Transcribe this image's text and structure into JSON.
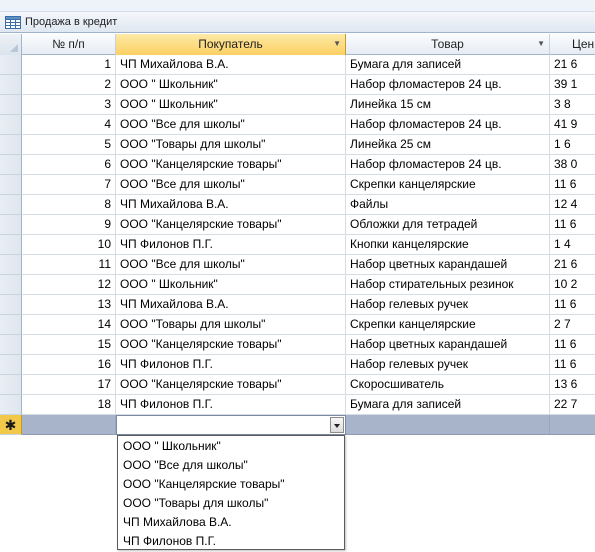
{
  "window": {
    "title": "Продажа в кредит",
    "icon": "table-icon"
  },
  "columns": {
    "num": "№ п/п",
    "buyer": "Покупатель",
    "item": "Товар",
    "price": "Цен"
  },
  "rows": [
    {
      "num": "1",
      "buyer": "ЧП Михайлова В.А.",
      "item": "Бумага для записей",
      "price": "21 6"
    },
    {
      "num": "2",
      "buyer": "ООО \" Школьник\"",
      "item": "Набор фломастеров 24 цв.",
      "price": "39 1"
    },
    {
      "num": "3",
      "buyer": "ООО \" Школьник\"",
      "item": "Линейка 15 см",
      "price": "3 8"
    },
    {
      "num": "4",
      "buyer": "ООО \"Все для школы\"",
      "item": "Набор фломастеров 24 цв.",
      "price": "41 9"
    },
    {
      "num": "5",
      "buyer": "ООО \"Товары для школы\"",
      "item": "Линейка 25 см",
      "price": "1 6"
    },
    {
      "num": "6",
      "buyer": "ООО \"Канцелярские товары\"",
      "item": "Набор фломастеров 24 цв.",
      "price": "38 0"
    },
    {
      "num": "7",
      "buyer": "ООО \"Все для школы\"",
      "item": "Скрепки канцелярские",
      "price": "11 6"
    },
    {
      "num": "8",
      "buyer": "ЧП Михайлова В.А.",
      "item": "Файлы",
      "price": "12 4"
    },
    {
      "num": "9",
      "buyer": "ООО \"Канцелярские товары\"",
      "item": "Обложки для тетрадей",
      "price": "11 6"
    },
    {
      "num": "10",
      "buyer": "ЧП Филонов П.Г.",
      "item": "Кнопки канцелярские",
      "price": "1 4"
    },
    {
      "num": "11",
      "buyer": "ООО \"Все для школы\"",
      "item": "Набор цветных карандашей",
      "price": "21 6"
    },
    {
      "num": "12",
      "buyer": "ООО \" Школьник\"",
      "item": "Набор стирательных резинок",
      "price": "10 2"
    },
    {
      "num": "13",
      "buyer": "ЧП Михайлова В.А.",
      "item": "Набор гелевых ручек",
      "price": "11 6"
    },
    {
      "num": "14",
      "buyer": "ООО \"Товары для школы\"",
      "item": "Скрепки канцелярские",
      "price": "2 7"
    },
    {
      "num": "15",
      "buyer": "ООО \"Канцелярские товары\"",
      "item": "Набор цветных карандашей",
      "price": "11 6"
    },
    {
      "num": "16",
      "buyer": "ЧП Филонов П.Г.",
      "item": "Набор гелевых ручек",
      "price": "11 6"
    },
    {
      "num": "17",
      "buyer": "ООО \"Канцелярские товары\"",
      "item": "Скоросшиватель",
      "price": "13 6"
    },
    {
      "num": "18",
      "buyer": "ЧП Филонов П.Г.",
      "item": "Бумага для записей",
      "price": "22 7"
    }
  ],
  "new_row": {
    "marker": "✱",
    "buyer_value": ""
  },
  "dropdown_options": [
    "ООО \" Школьник\"",
    "ООО \"Все для школы\"",
    "ООО \"Канцелярские товары\"",
    "ООО \"Товары для школы\"",
    "ЧП Михайлова В.А.",
    "ЧП Филонов П.Г."
  ],
  "colors": {
    "active_header": "#fbd063",
    "new_row_fill": "#a8b4c9",
    "new_row_marker": "#f1c84a"
  }
}
